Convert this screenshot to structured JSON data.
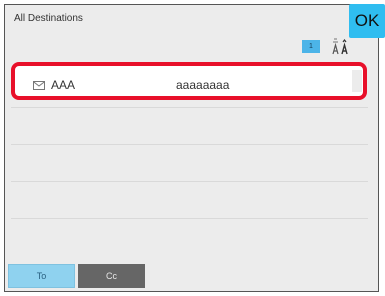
{
  "header": {
    "title": "All Destinations",
    "ok_label": "OK"
  },
  "pagination": {
    "page_number": "1"
  },
  "destinations": [
    {
      "name": "AAA",
      "address": "aaaaaaaa",
      "icon": "mail-icon",
      "selected": true
    }
  ],
  "tabs": [
    {
      "label": "To",
      "active": true
    },
    {
      "label": "Cc",
      "active": false
    }
  ],
  "colors": {
    "accent": "#2fbdf0",
    "selection_border": "#e8102a",
    "active_tab": "#8fd2ef",
    "inactive_tab": "#666666"
  }
}
